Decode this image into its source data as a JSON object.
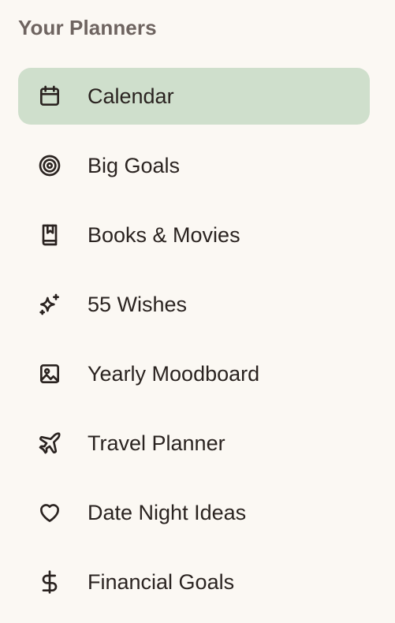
{
  "sidebar": {
    "heading": "Your Planners",
    "active_index": 0,
    "items": [
      {
        "label": "Calendar",
        "icon": "calendar-icon"
      },
      {
        "label": "Big Goals",
        "icon": "target-icon"
      },
      {
        "label": "Books & Movies",
        "icon": "book-icon"
      },
      {
        "label": "55 Wishes",
        "icon": "sparkles-icon"
      },
      {
        "label": "Yearly Moodboard",
        "icon": "image-icon"
      },
      {
        "label": "Travel Planner",
        "icon": "plane-icon"
      },
      {
        "label": "Date Night Ideas",
        "icon": "heart-icon"
      },
      {
        "label": "Financial Goals",
        "icon": "dollar-icon"
      }
    ]
  },
  "colors": {
    "background": "#FBF8F3",
    "active_background": "#CFDFCC",
    "heading_text": "#6E6460",
    "item_text": "#2A2320"
  }
}
